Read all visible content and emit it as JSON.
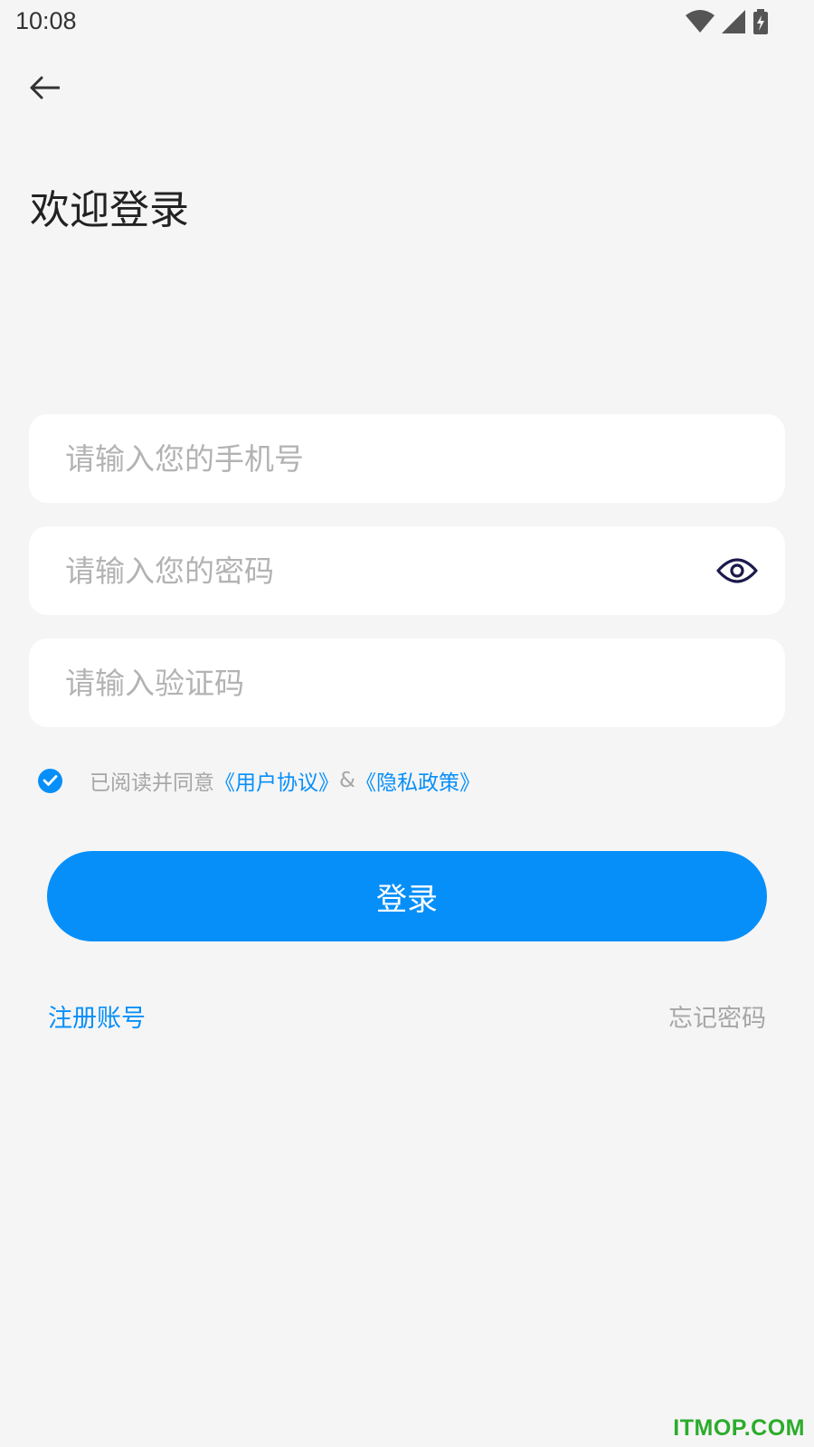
{
  "status_bar": {
    "time": "10:08",
    "icons": [
      "wifi-icon",
      "signal-icon",
      "battery-charging-icon"
    ]
  },
  "header": {
    "back_icon": "arrow-left-icon",
    "title": "欢迎登录"
  },
  "form": {
    "phone": {
      "placeholder": "请输入您的手机号",
      "value": ""
    },
    "password": {
      "placeholder": "请输入您的密码",
      "value": "",
      "toggle_icon": "eye-icon"
    },
    "code": {
      "placeholder": "请输入验证码",
      "value": ""
    }
  },
  "agreement": {
    "checked": true,
    "prefix": "已阅读并同意",
    "user_agreement": "《用户协议》",
    "separator": "&",
    "privacy_policy": "《隐私政策》"
  },
  "actions": {
    "login_label": "登录",
    "register_label": "注册账号",
    "forgot_label": "忘记密码"
  },
  "watermark": "ITMOP.COM",
  "colors": {
    "accent": "#078ff9",
    "background": "#f5f5f5",
    "placeholder": "#b3b3b3",
    "watermark": "#2bab2b"
  }
}
